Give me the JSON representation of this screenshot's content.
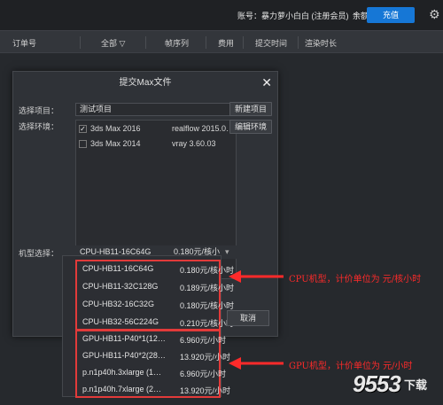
{
  "topbar": {
    "account_label": "账号：暴力萝小白白 (注册会员)",
    "balance_label": "余额：11.07",
    "recharge_label": "充值"
  },
  "table": {
    "columns": [
      "订单号",
      "全部 ▽",
      "帧序列",
      "费用",
      "提交时间",
      "渲染时长"
    ]
  },
  "dialog": {
    "title": "提交Max文件",
    "project_label": "选择项目：",
    "project_value": "测试项目",
    "new_project": "新建项目",
    "env_label": "选择环境：",
    "edit_env": "编辑环境",
    "environments": [
      {
        "name": "3ds Max 2016",
        "plugin": "realflow 2015.0…",
        "checked": true
      },
      {
        "name": "3ds Max 2014",
        "plugin": "vray 3.60.03",
        "checked": false
      }
    ],
    "machine_label": "机型选择：",
    "machine_value": "CPU-HB11-16C64G",
    "machine_price": "0.180元/核小",
    "cancel": "取消"
  },
  "dropdown": {
    "cpu": [
      {
        "name": "CPU-HB11-16C64G",
        "price": "0.180元/核小时"
      },
      {
        "name": "CPU-HB11-32C128G",
        "price": "0.189元/核小时"
      },
      {
        "name": "CPU-HB32-16C32G",
        "price": "0.180元/核小时"
      },
      {
        "name": "CPU-HB32-56C224G",
        "price": "0.210元/核小时"
      }
    ],
    "gpu": [
      {
        "name": "GPU-HB11-P40*1(12…",
        "price": "6.960元/小时"
      },
      {
        "name": "GPU-HB11-P40*2(28…",
        "price": "13.920元/小时"
      },
      {
        "name": "p.n1p40h.3xlarge (1…",
        "price": "6.960元/小时"
      },
      {
        "name": "p.n1p40h.7xlarge (2…",
        "price": "13.920元/小时"
      }
    ]
  },
  "annotations": {
    "cpu": "CPU机型，计价单位为 元/核小时",
    "gpu": "GPU机型，计价单位为 元/小时"
  },
  "watermark": {
    "main": "9553",
    "sub": "下载"
  }
}
